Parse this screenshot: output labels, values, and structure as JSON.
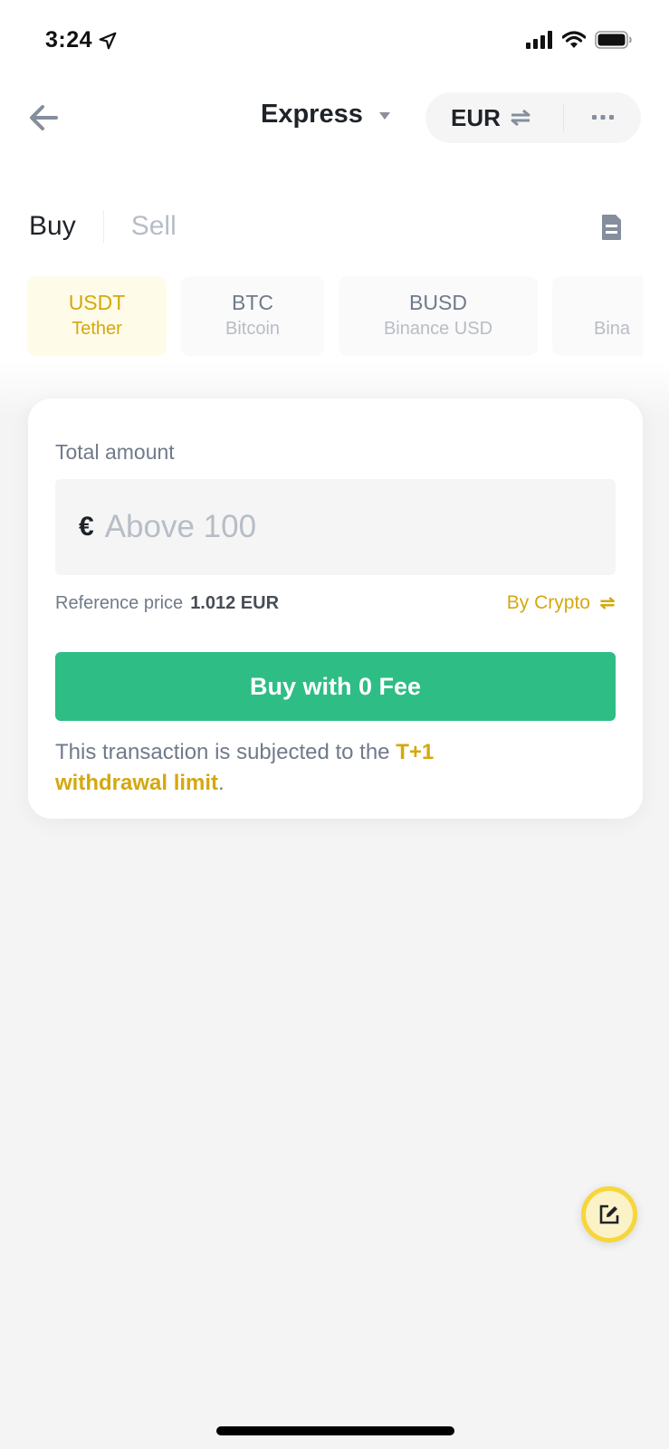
{
  "status_bar": {
    "time": "3:24",
    "icons": [
      "location-arrow-icon",
      "signal-bars-icon",
      "wifi-icon",
      "battery-icon"
    ]
  },
  "nav": {
    "back_icon": "arrow-left-icon",
    "title": "Express",
    "title_icon": "caret-down-icon",
    "currency": "EUR",
    "currency_icon": "swap-arrows-icon",
    "more_icon": "ellipsis-icon"
  },
  "tabs": {
    "items": [
      {
        "label": "Buy",
        "active": true
      },
      {
        "label": "Sell",
        "active": false
      }
    ],
    "orders_icon": "document-icon"
  },
  "coins": [
    {
      "symbol": "USDT",
      "name": "Tether",
      "selected": true
    },
    {
      "symbol": "BTC",
      "name": "Bitcoin",
      "selected": false
    },
    {
      "symbol": "BUSD",
      "name": "Binance USD",
      "selected": false
    },
    {
      "symbol": "",
      "name": "Bina",
      "selected": false
    }
  ],
  "card": {
    "label": "Total amount",
    "currency_symbol": "€",
    "amount_value": "",
    "amount_placeholder": "Above 100",
    "reference_label": "Reference price",
    "reference_value": "1.012 EUR",
    "toggle_label": "By Crypto",
    "toggle_icon": "swap-arrows-icon",
    "buy_button": "Buy with 0 Fee",
    "notice_text": "This transaction is subjected to the ",
    "notice_link": "T+1 withdrawal limit",
    "notice_end": "."
  },
  "fab": {
    "icon": "edit-note-icon"
  },
  "colors": {
    "accent": "#d4a80f",
    "buy_green": "#2ebd85",
    "selected_bg": "#fefbe8",
    "fab_ring": "#f6d63a"
  }
}
